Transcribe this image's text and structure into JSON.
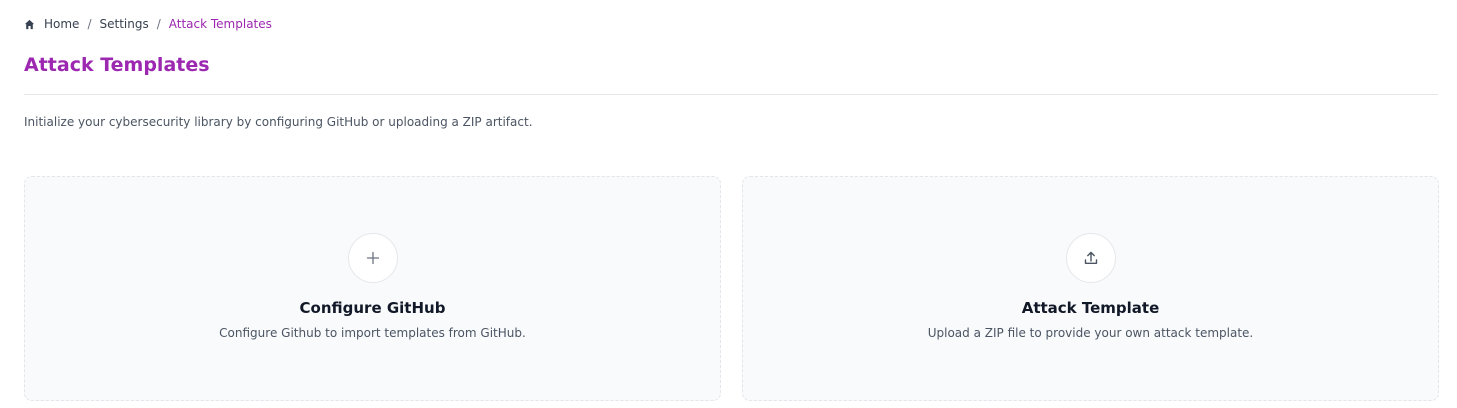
{
  "breadcrumb": {
    "home": "Home",
    "settings": "Settings",
    "current": "Attack Templates",
    "separator": "/"
  },
  "page": {
    "title": "Attack Templates",
    "description": "Initialize your cybersecurity library by configuring GitHub or uploading a ZIP artifact."
  },
  "cards": [
    {
      "icon": "plus-icon",
      "title": "Configure GitHub",
      "description": "Configure Github to import templates from GitHub."
    },
    {
      "icon": "upload-icon",
      "title": "Attack Template",
      "description": "Upload a ZIP file to provide your own attack template."
    }
  ],
  "colors": {
    "accent": "#9c27b0",
    "card_background": "#f9fafb",
    "card_border": "#e2e5ea",
    "muted_text": "#4b5563"
  }
}
